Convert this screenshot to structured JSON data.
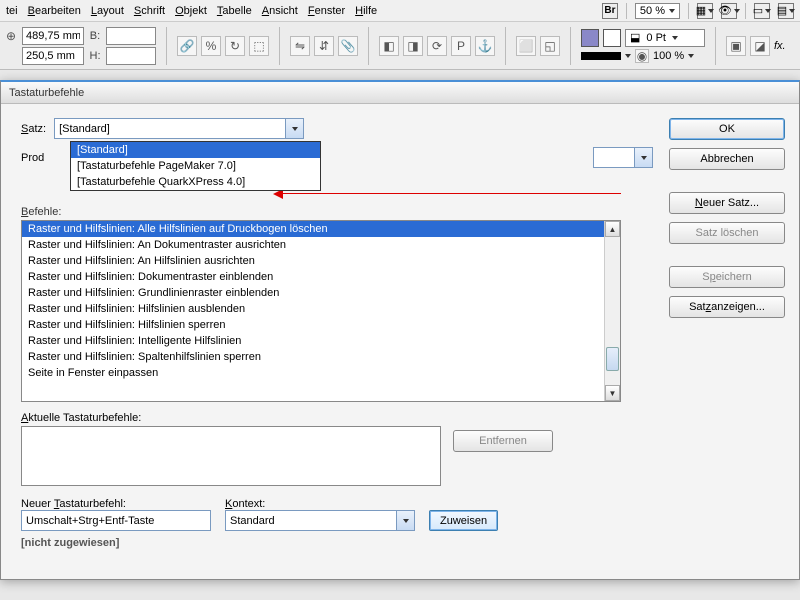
{
  "menu": {
    "datei": "tei",
    "bearbeiten": "Bearbeiten",
    "layout": "Layout",
    "schrift": "Schrift",
    "objekt": "Objekt",
    "tabelle": "Tabelle",
    "ansicht": "Ansicht",
    "fenster": "Fenster",
    "hilfe": "Hilfe",
    "br": "Br",
    "zoom": "50 %"
  },
  "coords": {
    "x_val": "489,75 mm",
    "y_val": "250,5 mm",
    "b_label": "B:",
    "h_label": "H:",
    "stroke": "0 Pt",
    "opacity": "100 %",
    "fx": "fx."
  },
  "dialog": {
    "title": "Tastaturbefehle",
    "satz_label": "Satz:",
    "satz_value": "[Standard]",
    "dropdown": {
      "opt1": "[Standard]",
      "opt2": "[Tastaturbefehle PageMaker 7.0]",
      "opt3": "[Tastaturbefehle QuarkXPress 4.0]"
    },
    "prod_label": "Prod",
    "befehle_label": "Befehle:",
    "list": [
      "Raster und Hilfslinien: Alle Hilfslinien auf Druckbogen löschen",
      "Raster und Hilfslinien: An Dokumentraster ausrichten",
      "Raster und Hilfslinien: An Hilfslinien ausrichten",
      "Raster und Hilfslinien: Dokumentraster einblenden",
      "Raster und Hilfslinien: Grundlinienraster einblenden",
      "Raster und Hilfslinien: Hilfslinien ausblenden",
      "Raster und Hilfslinien: Hilfslinien sperren",
      "Raster und Hilfslinien: Intelligente Hilfslinien",
      "Raster und Hilfslinien: Spaltenhilfslinien sperren",
      "Seite in Fenster einpassen"
    ],
    "aktuelle_label": "Aktuelle Tastaturbefehle:",
    "neuer_label": "Neuer Tastaturbefehl:",
    "neuer_value": "Umschalt+Strg+Entf-Taste",
    "kontext_label": "Kontext:",
    "kontext_value": "Standard",
    "zuweisen": "Zuweisen",
    "entfernen": "Entfernen",
    "nicht_zugewiesen": "[nicht zugewiesen]"
  },
  "buttons": {
    "ok": "OK",
    "abbrechen": "Abbrechen",
    "neuer_satz": "Neuer Satz...",
    "satz_loeschen": "Satz löschen",
    "speichern": "Speichern",
    "satz_anzeigen": "Satz anzeigen..."
  }
}
